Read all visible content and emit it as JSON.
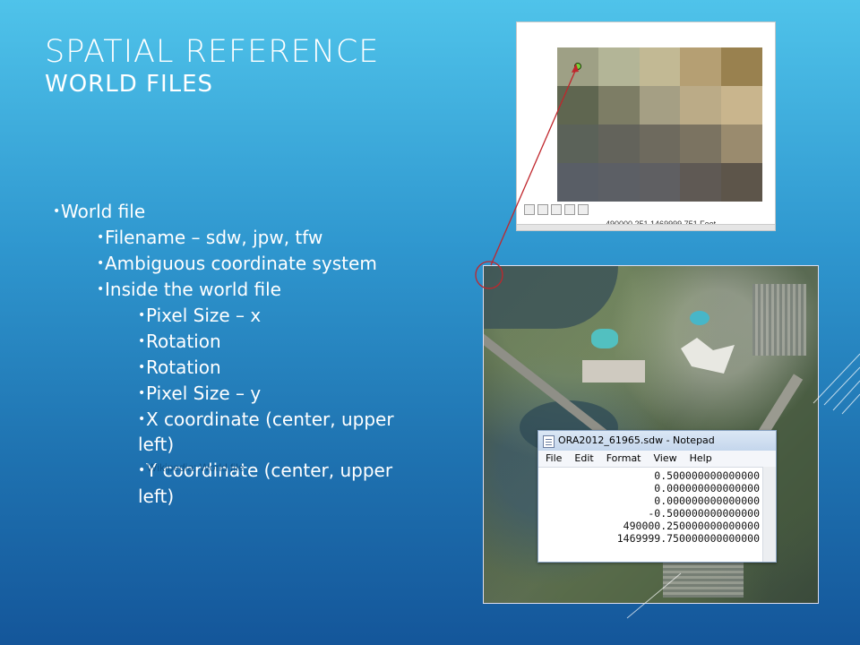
{
  "slide": {
    "title": "SPATIAL REFERENCE",
    "subtitle": "WORLD FILES",
    "bullets": [
      {
        "level": 1,
        "text": "World file"
      },
      {
        "level": 2,
        "text": "Filename – sdw, jpw, tfw"
      },
      {
        "level": 2,
        "text": "Ambiguous coordinate system"
      },
      {
        "level": 2,
        "text": "Inside the world file"
      },
      {
        "level": 3,
        "text": "Pixel Size – x"
      },
      {
        "level": 3,
        "text": "Rotation"
      },
      {
        "level": 3,
        "text": "Rotation"
      },
      {
        "level": 3,
        "text": "Pixel Size – y"
      },
      {
        "level": 3,
        "text": "X coordinate (center, upper"
      },
      {
        "level": 3,
        "text": "left)"
      },
      {
        "level": 3,
        "text": "Y coordinate (center, upper"
      },
      {
        "level": 3,
        "text": "left)"
      }
    ],
    "wiki_note": "Wikipedia: World file"
  },
  "map_panel": {
    "coords": "490000.251 1469999.751 Feet",
    "pixel_colors": [
      "#9ea085",
      "#b3b597",
      "#c2b994",
      "#b59f73",
      "#99814f",
      "#5f6650",
      "#7d7d65",
      "#a59f84",
      "#bbab87",
      "#c9b58d",
      "#5b6259",
      "#63635b",
      "#6e6a5e",
      "#7b7361",
      "#9a8b6e",
      "#595e66",
      "#5c5f65",
      "#5f5f62",
      "#5f5954",
      "#5d554a"
    ],
    "tool_icons": [
      "pointer-icon",
      "page-icon",
      "layout-icon",
      "refresh-icon",
      "pause-icon"
    ]
  },
  "notepad": {
    "title": "ORA2012_61965.sdw - Notepad",
    "menu": [
      "File",
      "Edit",
      "Format",
      "View",
      "Help"
    ],
    "lines": [
      "0.500000000000000",
      "0.000000000000000",
      "0.000000000000000",
      "-0.500000000000000",
      "490000.250000000000000",
      "1469999.750000000000000"
    ]
  },
  "colors": {
    "arrow": "#c0262c",
    "text": "#ffffff"
  }
}
